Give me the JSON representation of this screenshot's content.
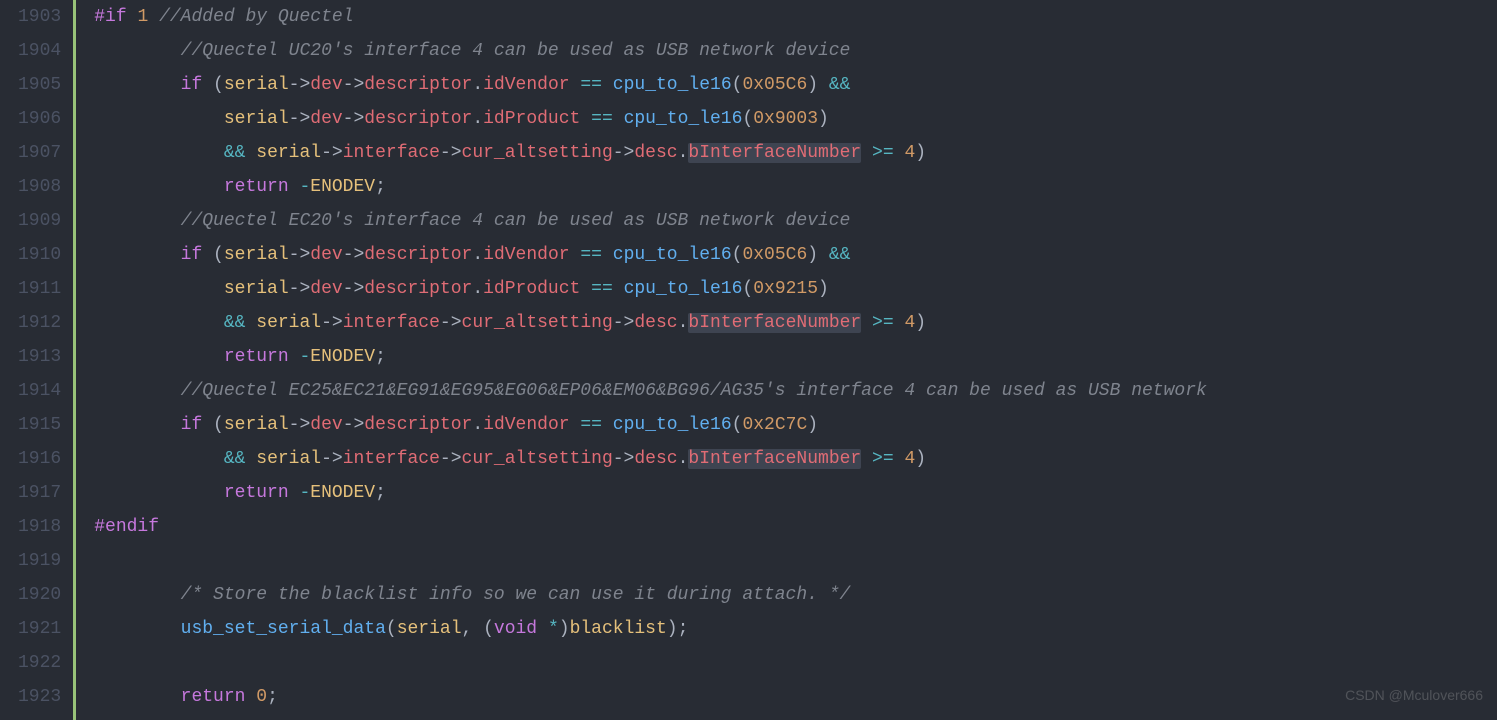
{
  "lines": [
    {
      "n": "1903",
      "seg": [
        {
          "t": "#if",
          "c": "c-preproc"
        },
        {
          "t": " ",
          "c": "c-plain"
        },
        {
          "t": "1",
          "c": "c-number"
        },
        {
          "t": " ",
          "c": "c-plain"
        },
        {
          "t": "//Added by Quectel",
          "c": "c-comment"
        }
      ],
      "ind": 0
    },
    {
      "n": "1904",
      "seg": [
        {
          "t": "//Quectel UC20's interface 4 can be used as USB network device",
          "c": "c-comment"
        }
      ],
      "ind": 2
    },
    {
      "n": "1905",
      "seg": [
        {
          "t": "if",
          "c": "c-keyword"
        },
        {
          "t": " (",
          "c": "c-plain"
        },
        {
          "t": "serial",
          "c": "c-var"
        },
        {
          "t": "->",
          "c": "c-plain"
        },
        {
          "t": "dev",
          "c": "c-member"
        },
        {
          "t": "->",
          "c": "c-plain"
        },
        {
          "t": "descriptor",
          "c": "c-member"
        },
        {
          "t": ".",
          "c": "c-plain"
        },
        {
          "t": "idVendor",
          "c": "c-member"
        },
        {
          "t": " ",
          "c": "c-plain"
        },
        {
          "t": "==",
          "c": "c-op"
        },
        {
          "t": " ",
          "c": "c-plain"
        },
        {
          "t": "cpu_to_le16",
          "c": "c-func"
        },
        {
          "t": "(",
          "c": "c-plain"
        },
        {
          "t": "0x05C6",
          "c": "c-number"
        },
        {
          "t": ") ",
          "c": "c-plain"
        },
        {
          "t": "&&",
          "c": "c-op"
        }
      ],
      "ind": 2
    },
    {
      "n": "1906",
      "seg": [
        {
          "t": "serial",
          "c": "c-var"
        },
        {
          "t": "->",
          "c": "c-plain"
        },
        {
          "t": "dev",
          "c": "c-member"
        },
        {
          "t": "->",
          "c": "c-plain"
        },
        {
          "t": "descriptor",
          "c": "c-member"
        },
        {
          "t": ".",
          "c": "c-plain"
        },
        {
          "t": "idProduct",
          "c": "c-member"
        },
        {
          "t": " ",
          "c": "c-plain"
        },
        {
          "t": "==",
          "c": "c-op"
        },
        {
          "t": " ",
          "c": "c-plain"
        },
        {
          "t": "cpu_to_le16",
          "c": "c-func"
        },
        {
          "t": "(",
          "c": "c-plain"
        },
        {
          "t": "0x9003",
          "c": "c-number"
        },
        {
          "t": ")",
          "c": "c-plain"
        }
      ],
      "ind": 3
    },
    {
      "n": "1907",
      "seg": [
        {
          "t": "&&",
          "c": "c-op"
        },
        {
          "t": " ",
          "c": "c-plain"
        },
        {
          "t": "serial",
          "c": "c-var"
        },
        {
          "t": "->",
          "c": "c-plain"
        },
        {
          "t": "interface",
          "c": "c-member"
        },
        {
          "t": "->",
          "c": "c-plain"
        },
        {
          "t": "cur_altsetting",
          "c": "c-member"
        },
        {
          "t": "->",
          "c": "c-plain"
        },
        {
          "t": "desc",
          "c": "c-member"
        },
        {
          "t": ".",
          "c": "c-plain"
        },
        {
          "t": "bInterfaceNumber",
          "c": "c-member",
          "hl": true
        },
        {
          "t": " ",
          "c": "c-plain"
        },
        {
          "t": ">=",
          "c": "c-op"
        },
        {
          "t": " ",
          "c": "c-plain"
        },
        {
          "t": "4",
          "c": "c-number"
        },
        {
          "t": ")",
          "c": "c-plain"
        }
      ],
      "ind": 3
    },
    {
      "n": "1908",
      "seg": [
        {
          "t": "return",
          "c": "c-keyword"
        },
        {
          "t": " ",
          "c": "c-plain"
        },
        {
          "t": "-",
          "c": "c-op"
        },
        {
          "t": "ENODEV",
          "c": "c-macro"
        },
        {
          "t": ";",
          "c": "c-plain"
        }
      ],
      "ind": 3
    },
    {
      "n": "1909",
      "seg": [
        {
          "t": "//Quectel EC20's interface 4 can be used as USB network device",
          "c": "c-comment"
        }
      ],
      "ind": 2
    },
    {
      "n": "1910",
      "seg": [
        {
          "t": "if",
          "c": "c-keyword"
        },
        {
          "t": " (",
          "c": "c-plain"
        },
        {
          "t": "serial",
          "c": "c-var"
        },
        {
          "t": "->",
          "c": "c-plain"
        },
        {
          "t": "dev",
          "c": "c-member"
        },
        {
          "t": "->",
          "c": "c-plain"
        },
        {
          "t": "descriptor",
          "c": "c-member"
        },
        {
          "t": ".",
          "c": "c-plain"
        },
        {
          "t": "idVendor",
          "c": "c-member"
        },
        {
          "t": " ",
          "c": "c-plain"
        },
        {
          "t": "==",
          "c": "c-op"
        },
        {
          "t": " ",
          "c": "c-plain"
        },
        {
          "t": "cpu_to_le16",
          "c": "c-func"
        },
        {
          "t": "(",
          "c": "c-plain"
        },
        {
          "t": "0x05C6",
          "c": "c-number"
        },
        {
          "t": ") ",
          "c": "c-plain"
        },
        {
          "t": "&&",
          "c": "c-op"
        }
      ],
      "ind": 2
    },
    {
      "n": "1911",
      "seg": [
        {
          "t": "serial",
          "c": "c-var"
        },
        {
          "t": "->",
          "c": "c-plain"
        },
        {
          "t": "dev",
          "c": "c-member"
        },
        {
          "t": "->",
          "c": "c-plain"
        },
        {
          "t": "descriptor",
          "c": "c-member"
        },
        {
          "t": ".",
          "c": "c-plain"
        },
        {
          "t": "idProduct",
          "c": "c-member"
        },
        {
          "t": " ",
          "c": "c-plain"
        },
        {
          "t": "==",
          "c": "c-op"
        },
        {
          "t": " ",
          "c": "c-plain"
        },
        {
          "t": "cpu_to_le16",
          "c": "c-func"
        },
        {
          "t": "(",
          "c": "c-plain"
        },
        {
          "t": "0x9215",
          "c": "c-number"
        },
        {
          "t": ")",
          "c": "c-plain"
        }
      ],
      "ind": 3
    },
    {
      "n": "1912",
      "seg": [
        {
          "t": "&&",
          "c": "c-op"
        },
        {
          "t": " ",
          "c": "c-plain"
        },
        {
          "t": "serial",
          "c": "c-var"
        },
        {
          "t": "->",
          "c": "c-plain"
        },
        {
          "t": "interface",
          "c": "c-member"
        },
        {
          "t": "->",
          "c": "c-plain"
        },
        {
          "t": "cur_altsetting",
          "c": "c-member"
        },
        {
          "t": "->",
          "c": "c-plain"
        },
        {
          "t": "desc",
          "c": "c-member"
        },
        {
          "t": ".",
          "c": "c-plain"
        },
        {
          "t": "bInterfaceNumber",
          "c": "c-member",
          "hl": true
        },
        {
          "t": " ",
          "c": "c-plain"
        },
        {
          "t": ">=",
          "c": "c-op"
        },
        {
          "t": " ",
          "c": "c-plain"
        },
        {
          "t": "4",
          "c": "c-number"
        },
        {
          "t": ")",
          "c": "c-plain"
        }
      ],
      "ind": 3
    },
    {
      "n": "1913",
      "seg": [
        {
          "t": "return",
          "c": "c-keyword"
        },
        {
          "t": " ",
          "c": "c-plain"
        },
        {
          "t": "-",
          "c": "c-op"
        },
        {
          "t": "ENODEV",
          "c": "c-macro"
        },
        {
          "t": ";",
          "c": "c-plain"
        }
      ],
      "ind": 3
    },
    {
      "n": "1914",
      "seg": [
        {
          "t": "//Quectel EC25&EC21&EG91&EG95&EG06&EP06&EM06&BG96/AG35's interface 4 can be used as USB network",
          "c": "c-comment"
        }
      ],
      "ind": 2
    },
    {
      "n": "1915",
      "seg": [
        {
          "t": "if",
          "c": "c-keyword"
        },
        {
          "t": " (",
          "c": "c-plain"
        },
        {
          "t": "serial",
          "c": "c-var"
        },
        {
          "t": "->",
          "c": "c-plain"
        },
        {
          "t": "dev",
          "c": "c-member"
        },
        {
          "t": "->",
          "c": "c-plain"
        },
        {
          "t": "descriptor",
          "c": "c-member"
        },
        {
          "t": ".",
          "c": "c-plain"
        },
        {
          "t": "idVendor",
          "c": "c-member"
        },
        {
          "t": " ",
          "c": "c-plain"
        },
        {
          "t": "==",
          "c": "c-op"
        },
        {
          "t": " ",
          "c": "c-plain"
        },
        {
          "t": "cpu_to_le16",
          "c": "c-func"
        },
        {
          "t": "(",
          "c": "c-plain"
        },
        {
          "t": "0x2C7C",
          "c": "c-number"
        },
        {
          "t": ")",
          "c": "c-plain"
        }
      ],
      "ind": 2
    },
    {
      "n": "1916",
      "seg": [
        {
          "t": "&&",
          "c": "c-op"
        },
        {
          "t": " ",
          "c": "c-plain"
        },
        {
          "t": "serial",
          "c": "c-var"
        },
        {
          "t": "->",
          "c": "c-plain"
        },
        {
          "t": "interface",
          "c": "c-member"
        },
        {
          "t": "->",
          "c": "c-plain"
        },
        {
          "t": "cur_altsetting",
          "c": "c-member"
        },
        {
          "t": "->",
          "c": "c-plain"
        },
        {
          "t": "desc",
          "c": "c-member"
        },
        {
          "t": ".",
          "c": "c-plain"
        },
        {
          "t": "bInterfaceNumber",
          "c": "c-member",
          "hl": true
        },
        {
          "t": " ",
          "c": "c-plain"
        },
        {
          "t": ">=",
          "c": "c-op"
        },
        {
          "t": " ",
          "c": "c-plain"
        },
        {
          "t": "4",
          "c": "c-number"
        },
        {
          "t": ")",
          "c": "c-plain"
        }
      ],
      "ind": 3
    },
    {
      "n": "1917",
      "seg": [
        {
          "t": "return",
          "c": "c-keyword"
        },
        {
          "t": " ",
          "c": "c-plain"
        },
        {
          "t": "-",
          "c": "c-op"
        },
        {
          "t": "ENODEV",
          "c": "c-macro"
        },
        {
          "t": ";",
          "c": "c-plain"
        }
      ],
      "ind": 3
    },
    {
      "n": "1918",
      "seg": [
        {
          "t": "#endif",
          "c": "c-preproc"
        }
      ],
      "ind": 0
    },
    {
      "n": "1919",
      "seg": [
        {
          "t": "",
          "c": "c-plain"
        }
      ],
      "ind": 0
    },
    {
      "n": "1920",
      "seg": [
        {
          "t": "/* Store the blacklist info so we can use it during attach. */",
          "c": "c-comment"
        }
      ],
      "ind": 2
    },
    {
      "n": "1921",
      "seg": [
        {
          "t": "usb_set_serial_data",
          "c": "c-func"
        },
        {
          "t": "(",
          "c": "c-plain"
        },
        {
          "t": "serial",
          "c": "c-var"
        },
        {
          "t": ", (",
          "c": "c-plain"
        },
        {
          "t": "void",
          "c": "c-keyword"
        },
        {
          "t": " ",
          "c": "c-plain"
        },
        {
          "t": "*",
          "c": "c-op"
        },
        {
          "t": ")",
          "c": "c-plain"
        },
        {
          "t": "blacklist",
          "c": "c-var"
        },
        {
          "t": ");",
          "c": "c-plain"
        }
      ],
      "ind": 2
    },
    {
      "n": "1922",
      "seg": [
        {
          "t": "",
          "c": "c-plain"
        }
      ],
      "ind": 0
    },
    {
      "n": "1923",
      "seg": [
        {
          "t": "return",
          "c": "c-keyword"
        },
        {
          "t": " ",
          "c": "c-plain"
        },
        {
          "t": "0",
          "c": "c-number"
        },
        {
          "t": ";",
          "c": "c-plain"
        }
      ],
      "ind": 2
    }
  ],
  "watermark": "CSDN @Mculover666",
  "indent_unit": "    "
}
